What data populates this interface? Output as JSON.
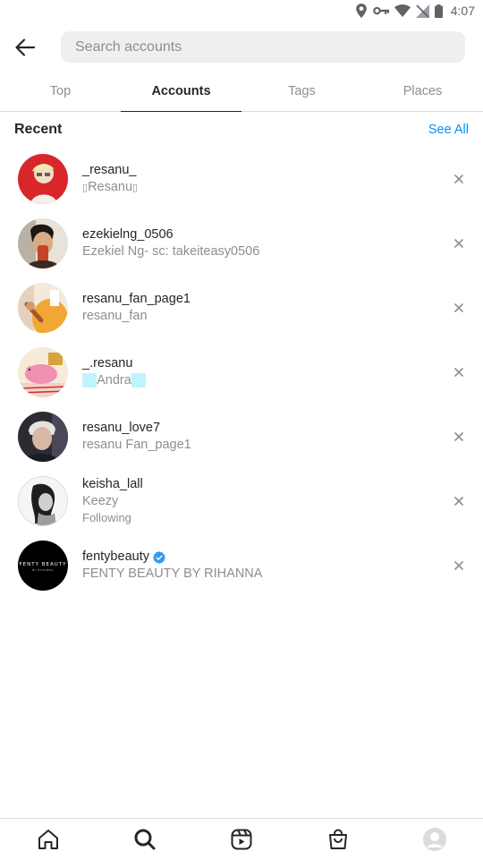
{
  "status_bar": {
    "time": "4:07",
    "icons": [
      "location-icon",
      "vpn-key-icon",
      "wifi-icon",
      "no-signal-icon",
      "battery-icon"
    ]
  },
  "search": {
    "placeholder": "Search accounts",
    "value": ""
  },
  "tabs": [
    {
      "label": "Top",
      "active": false
    },
    {
      "label": "Accounts",
      "active": true
    },
    {
      "label": "Tags",
      "active": false
    },
    {
      "label": "Places",
      "active": false
    }
  ],
  "recent": {
    "title": "Recent",
    "see_all": "See All"
  },
  "accounts": [
    {
      "username": "_resanu_",
      "full_name": "Resanu",
      "extra": "",
      "verified": false
    },
    {
      "username": "ezekielng_0506",
      "full_name": "Ezekiel Ng- sc: takeiteasy0506",
      "extra": "",
      "verified": false
    },
    {
      "username": "resanu_fan_page1",
      "full_name": "resanu_fan",
      "extra": "",
      "verified": false
    },
    {
      "username": "_.resanu",
      "full_name": "Andra",
      "extra": "",
      "verified": false
    },
    {
      "username": "resanu_love7",
      "full_name": "resanu Fan_page1",
      "extra": "",
      "verified": false
    },
    {
      "username": "keisha_lall",
      "full_name": "Keezy",
      "extra": "Following",
      "verified": false
    },
    {
      "username": "fentybeauty",
      "full_name": "FENTY BEAUTY BY RIHANNA",
      "extra": "",
      "verified": true
    }
  ],
  "bottom_nav": [
    "home-icon",
    "search-icon",
    "reels-icon",
    "shop-icon",
    "profile-icon"
  ],
  "colors": {
    "accent": "#0095f6",
    "text_primary": "#262626",
    "text_secondary": "#8e8e8e",
    "divider": "#dbdbdb",
    "search_bg": "#efefef"
  }
}
